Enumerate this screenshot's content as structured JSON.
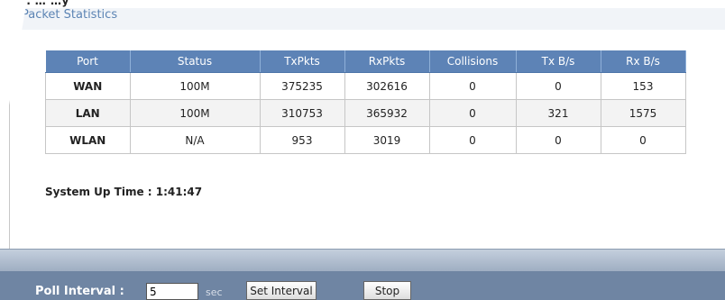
{
  "top_caption": "…g… … …y",
  "panel": {
    "title": "Packet Statistics"
  },
  "table": {
    "headers": [
      "Port",
      "Status",
      "TxPkts",
      "RxPkts",
      "Collisions",
      "Tx B/s",
      "Rx B/s"
    ],
    "rows": [
      {
        "port": "WAN",
        "status": "100M",
        "tx_pkts": "375235",
        "rx_pkts": "302616",
        "collisions": "0",
        "tx_bps": "0",
        "rx_bps": "153"
      },
      {
        "port": "LAN",
        "status": "100M",
        "tx_pkts": "310753",
        "rx_pkts": "365932",
        "collisions": "0",
        "tx_bps": "321",
        "rx_bps": "1575"
      },
      {
        "port": "WLAN",
        "status": "N/A",
        "tx_pkts": "953",
        "rx_pkts": "3019",
        "collisions": "0",
        "tx_bps": "0",
        "rx_bps": "0"
      }
    ]
  },
  "uptime": {
    "label": "System Up Time :",
    "value": "1:41:47"
  },
  "footer": {
    "poll_label": "Poll Interval :",
    "poll_value": "5",
    "poll_unit": "sec",
    "set_interval_label": "Set Interval",
    "stop_label": "Stop"
  },
  "colors": {
    "header_bg": "#5d83b6",
    "title_color": "#5c84b4",
    "footer_bg": "#6f85a3"
  }
}
